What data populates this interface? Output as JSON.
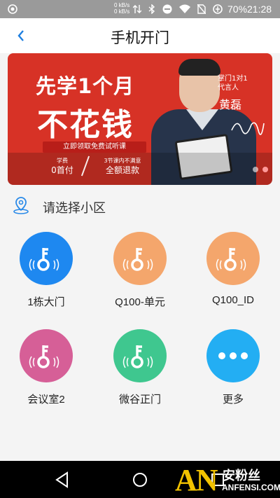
{
  "status_bar": {
    "speed_up": "0 kB/s",
    "speed_down": "0 kB/s",
    "battery": "70%",
    "time": "21:28"
  },
  "header": {
    "title": "手机开门"
  },
  "banner": {
    "headline_1": "先学1个月",
    "headline_2": "不花钱",
    "cta": "立即领取免费试听课",
    "fee_label": "学费",
    "fee_value": "0首付",
    "refund_label": "3节课内不满意",
    "refund_value": "全额退款",
    "tag": "掌门1对1\n代言人",
    "name": "黄磊",
    "dots": 2,
    "active_dot": 1
  },
  "community": {
    "label": "请选择小区"
  },
  "doors": [
    {
      "label": "1栋大门",
      "color": "#1e88f0",
      "icon": "key-icon"
    },
    {
      "label": "Q100-单元",
      "color": "#f4a66c",
      "icon": "key-icon"
    },
    {
      "label": "Q100_ID",
      "color": "#f4a66c",
      "icon": "key-icon"
    },
    {
      "label": "会议室2",
      "color": "#d65f97",
      "icon": "key-icon"
    },
    {
      "label": "微谷正门",
      "color": "#3fc78f",
      "icon": "key-icon"
    },
    {
      "label": "更多",
      "color": "#23aef3",
      "icon": "more-icon"
    }
  ],
  "watermark": {
    "logo": "AN",
    "cn": "安粉丝",
    "en": "ANFENSI.COM"
  }
}
